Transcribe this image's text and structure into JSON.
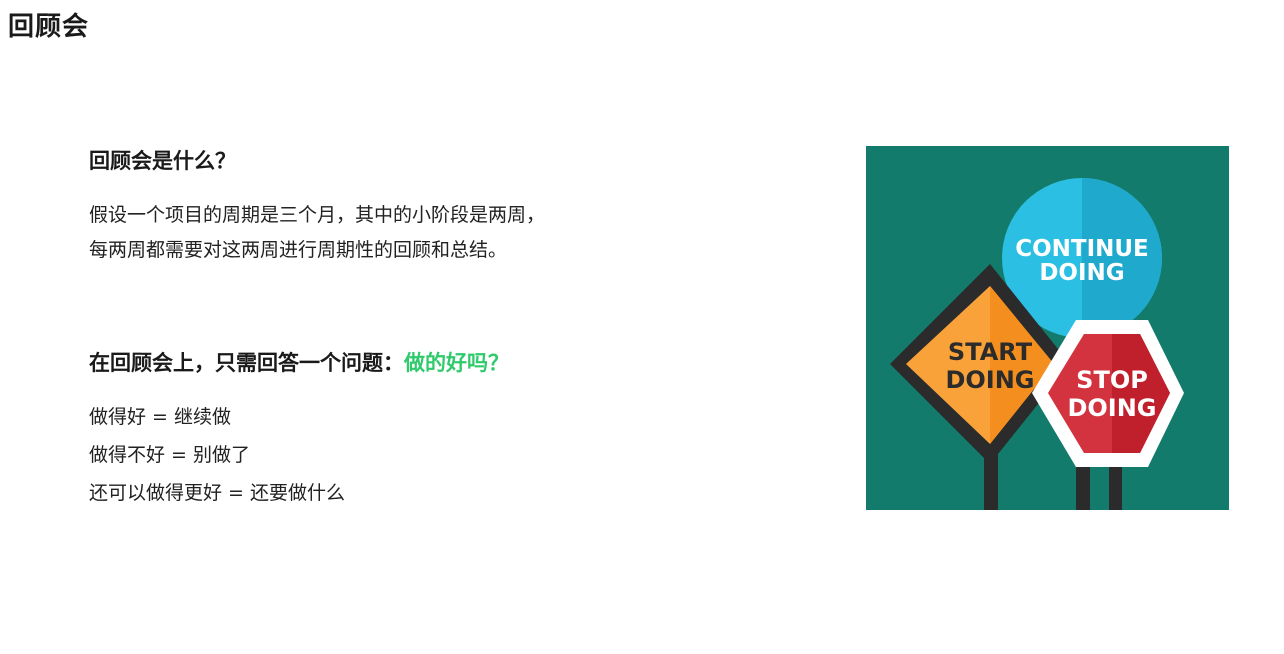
{
  "title": "回顾会",
  "section1": {
    "heading": "回顾会是什么？",
    "lines": [
      "假设一个项目的周期是三个月，其中的小阶段是两周，",
      "每两周都需要对这两周进行周期性的回顾和总结。"
    ]
  },
  "section2": {
    "heading": "在回顾会上，只需回答一个问题：",
    "highlight": "做的好吗？",
    "answers": [
      "做得好 = 继续做",
      "做得不好 = 别做了",
      "还可以做得更好 = 还要做什么"
    ]
  },
  "illustration": {
    "continue_line1": "CONTINUE",
    "continue_line2": "DOING",
    "start_line1": "START",
    "start_line2": "DOING",
    "stop_line1": "STOP",
    "stop_line2": "DOING"
  },
  "colors": {
    "highlight": "#2fca6c",
    "teal_background": "#137b6b",
    "continue_sign": "#2bbfe3",
    "start_sign": "#f9a23a",
    "stop_sign": "#d3333e"
  }
}
